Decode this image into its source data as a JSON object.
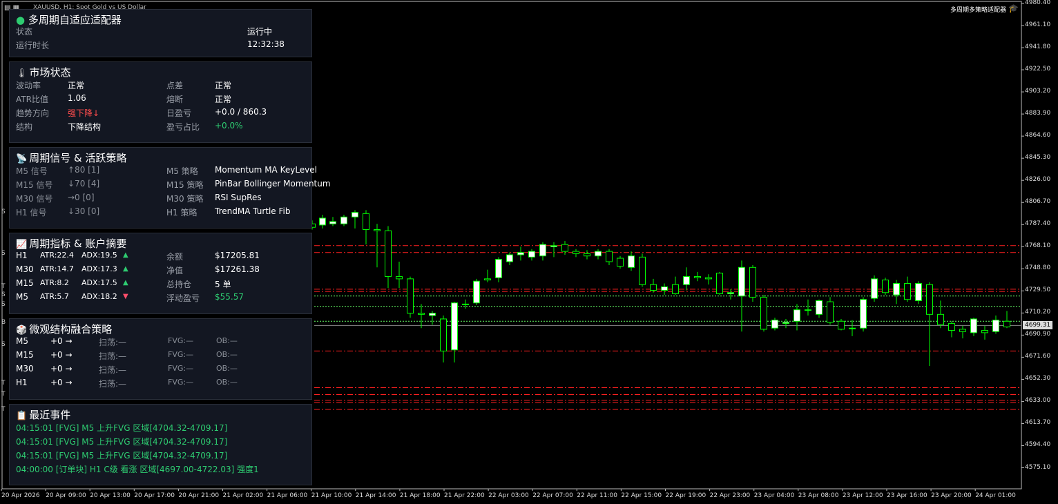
{
  "window": {
    "title": "XAUUSD, H1: Spot Gold vs US Dollar",
    "ea_name": "多周期多策略适配器"
  },
  "colors": {
    "background": "#000000",
    "bull": "#ffffff",
    "bear": "#ffffff",
    "wick": "#00ff00",
    "level_red": "#ff2020",
    "level_green": "#66ff66",
    "accent_green": "#2ecc71",
    "accent_red": "#ff4d4d"
  },
  "side_labels": [
    "S",
    "S",
    "T",
    "S",
    "S",
    "B",
    "S",
    "T",
    "T",
    "T"
  ],
  "y_axis": [
    "4980.40",
    "4961.10",
    "4941.80",
    "4922.50",
    "4903.20",
    "4883.90",
    "4864.60",
    "4845.30",
    "4826.00",
    "4806.70",
    "4787.40",
    "4768.10",
    "4748.80",
    "4729.50",
    "4710.20",
    "4690.90",
    "4671.60",
    "4652.30",
    "4633.00",
    "4613.70",
    "4594.40",
    "4575.10"
  ],
  "current_price": "4699.31",
  "x_axis": [
    "20 Apr 2026",
    "20 Apr 09:00",
    "20 Apr 13:00",
    "20 Apr 17:00",
    "20 Apr 21:00",
    "21 Apr 02:00",
    "21 Apr 06:00",
    "21 Apr 10:00",
    "21 Apr 14:00",
    "21 Apr 18:00",
    "21 Apr 22:00",
    "22 Apr 03:00",
    "22 Apr 07:00",
    "22 Apr 11:00",
    "22 Apr 15:00",
    "22 Apr 19:00",
    "22 Apr 23:00",
    "23 Apr 04:00",
    "23 Apr 08:00",
    "23 Apr 12:00",
    "23 Apr 16:00",
    "23 Apr 20:00",
    "24 Apr 01:00"
  ],
  "chart_data": {
    "type": "candlestick",
    "title": "XAUUSD, H1: Spot Gold vs US Dollar",
    "ylim": [
      4556,
      4981
    ],
    "current": 4699.31,
    "red_levels": [
      4769,
      4763,
      4731,
      4729,
      4677,
      4645,
      4639,
      4634,
      4632,
      4626
    ],
    "green_levels": [
      4725,
      4716,
      4703
    ],
    "candles": [
      {
        "x": 437,
        "o": 4790,
        "c": 4787,
        "h": 4793,
        "l": 4784
      },
      {
        "x": 452,
        "o": 4788,
        "c": 4785,
        "h": 4791,
        "l": 4783
      },
      {
        "x": 467,
        "o": 4787,
        "c": 4793,
        "h": 4796,
        "l": 4784
      },
      {
        "x": 482,
        "o": 4788,
        "c": 4790,
        "h": 4794,
        "l": 4786
      },
      {
        "x": 498,
        "o": 4788,
        "c": 4794,
        "h": 4796,
        "l": 4786
      },
      {
        "x": 514,
        "o": 4794,
        "c": 4798,
        "h": 4800,
        "l": 4784
      },
      {
        "x": 530,
        "o": 4797,
        "c": 4783,
        "h": 4800,
        "l": 4770
      },
      {
        "x": 546,
        "o": 4783,
        "c": 4782,
        "h": 4788,
        "l": 4750
      },
      {
        "x": 562,
        "o": 4782,
        "c": 4742,
        "h": 4786,
        "l": 4732
      },
      {
        "x": 578,
        "o": 4742,
        "c": 4740,
        "h": 4755,
        "l": 4732
      },
      {
        "x": 594,
        "o": 4740,
        "c": 4710,
        "h": 4742,
        "l": 4706
      },
      {
        "x": 610,
        "o": 4710,
        "c": 4709,
        "h": 4718,
        "l": 4697
      },
      {
        "x": 626,
        "o": 4708,
        "c": 4710,
        "h": 4712,
        "l": 4700
      },
      {
        "x": 642,
        "o": 4705,
        "c": 4677,
        "h": 4708,
        "l": 4667
      },
      {
        "x": 658,
        "o": 4678,
        "c": 4719,
        "h": 4720,
        "l": 4667
      },
      {
        "x": 674,
        "o": 4718,
        "c": 4718,
        "h": 4722,
        "l": 4714
      },
      {
        "x": 690,
        "o": 4719,
        "c": 4738,
        "h": 4740,
        "l": 4717
      },
      {
        "x": 706,
        "o": 4740,
        "c": 4739,
        "h": 4748,
        "l": 4737
      },
      {
        "x": 722,
        "o": 4741,
        "c": 4757,
        "h": 4759,
        "l": 4737
      },
      {
        "x": 738,
        "o": 4755,
        "c": 4761,
        "h": 4763,
        "l": 4752
      },
      {
        "x": 754,
        "o": 4761,
        "c": 4763,
        "h": 4768,
        "l": 4756
      },
      {
        "x": 770,
        "o": 4759,
        "c": 4764,
        "h": 4766,
        "l": 4756
      },
      {
        "x": 786,
        "o": 4760,
        "c": 4770,
        "h": 4772,
        "l": 4756
      },
      {
        "x": 802,
        "o": 4768,
        "c": 4769,
        "h": 4772,
        "l": 4759
      },
      {
        "x": 818,
        "o": 4770,
        "c": 4764,
        "h": 4773,
        "l": 4761
      },
      {
        "x": 834,
        "o": 4764,
        "c": 4762,
        "h": 4766,
        "l": 4759
      },
      {
        "x": 850,
        "o": 4762,
        "c": 4760,
        "h": 4765,
        "l": 4757
      },
      {
        "x": 866,
        "o": 4760,
        "c": 4764,
        "h": 4766,
        "l": 4757
      },
      {
        "x": 882,
        "o": 4764,
        "c": 4755,
        "h": 4766,
        "l": 4752
      },
      {
        "x": 898,
        "o": 4758,
        "c": 4751,
        "h": 4760,
        "l": 4749
      },
      {
        "x": 914,
        "o": 4750,
        "c": 4760,
        "h": 4764,
        "l": 4747
      },
      {
        "x": 930,
        "o": 4759,
        "c": 4735,
        "h": 4762,
        "l": 4733
      },
      {
        "x": 946,
        "o": 4735,
        "c": 4730,
        "h": 4740,
        "l": 4728
      },
      {
        "x": 962,
        "o": 4730,
        "c": 4733,
        "h": 4736,
        "l": 4726
      },
      {
        "x": 978,
        "o": 4735,
        "c": 4727,
        "h": 4742,
        "l": 4726
      },
      {
        "x": 994,
        "o": 4735,
        "c": 4742,
        "h": 4750,
        "l": 4730
      },
      {
        "x": 1010,
        "o": 4742,
        "c": 4741,
        "h": 4746,
        "l": 4738
      },
      {
        "x": 1026,
        "o": 4741,
        "c": 4740,
        "h": 4744,
        "l": 4735
      },
      {
        "x": 1042,
        "o": 4745,
        "c": 4727,
        "h": 4746,
        "l": 4726
      },
      {
        "x": 1058,
        "o": 4727,
        "c": 4728,
        "h": 4731,
        "l": 4722
      },
      {
        "x": 1074,
        "o": 4725,
        "c": 4750,
        "h": 4756,
        "l": 4694
      },
      {
        "x": 1090,
        "o": 4750,
        "c": 4724,
        "h": 4752,
        "l": 4720
      },
      {
        "x": 1106,
        "o": 4724,
        "c": 4696,
        "h": 4726,
        "l": 4694
      },
      {
        "x": 1122,
        "o": 4697,
        "c": 4704,
        "h": 4706,
        "l": 4695
      },
      {
        "x": 1138,
        "o": 4701,
        "c": 4702,
        "h": 4705,
        "l": 4697
      },
      {
        "x": 1154,
        "o": 4703,
        "c": 4713,
        "h": 4718,
        "l": 4695
      },
      {
        "x": 1170,
        "o": 4713,
        "c": 4713,
        "h": 4722,
        "l": 4708
      },
      {
        "x": 1186,
        "o": 4709,
        "c": 4721,
        "h": 4722,
        "l": 4706
      },
      {
        "x": 1202,
        "o": 4720,
        "c": 4702,
        "h": 4724,
        "l": 4700
      },
      {
        "x": 1218,
        "o": 4703,
        "c": 4696,
        "h": 4705,
        "l": 4695
      },
      {
        "x": 1234,
        "o": 4697,
        "c": 4697,
        "h": 4704,
        "l": 4690
      },
      {
        "x": 1250,
        "o": 4697,
        "c": 4722,
        "h": 4724,
        "l": 4694
      },
      {
        "x": 1266,
        "o": 4723,
        "c": 4740,
        "h": 4743,
        "l": 4720
      },
      {
        "x": 1282,
        "o": 4739,
        "c": 4728,
        "h": 4741,
        "l": 4726
      },
      {
        "x": 1298,
        "o": 4726,
        "c": 4736,
        "h": 4739,
        "l": 4718
      },
      {
        "x": 1314,
        "o": 4736,
        "c": 4722,
        "h": 4742,
        "l": 4720
      },
      {
        "x": 1330,
        "o": 4721,
        "c": 4736,
        "h": 4738,
        "l": 4718
      },
      {
        "x": 1346,
        "o": 4735,
        "c": 4709,
        "h": 4737,
        "l": 4664
      },
      {
        "x": 1362,
        "o": 4709,
        "c": 4700,
        "h": 4721,
        "l": 4697
      },
      {
        "x": 1378,
        "o": 4701,
        "c": 4695,
        "h": 4703,
        "l": 4689
      },
      {
        "x": 1394,
        "o": 4696,
        "c": 4694,
        "h": 4699,
        "l": 4688
      },
      {
        "x": 1410,
        "o": 4693,
        "c": 4705,
        "h": 4706,
        "l": 4690
      },
      {
        "x": 1426,
        "o": 4695,
        "c": 4693,
        "h": 4699,
        "l": 4687
      },
      {
        "x": 1442,
        "o": 4694,
        "c": 4704,
        "h": 4708,
        "l": 4692
      },
      {
        "x": 1458,
        "o": 4703,
        "c": 4698,
        "h": 4712,
        "l": 4697
      }
    ]
  },
  "panel1": {
    "title": "多周期自适应适配器",
    "rows": [
      {
        "label": "状态",
        "value": "运行中"
      },
      {
        "label": "运行时长",
        "value": "12:32:38"
      }
    ]
  },
  "panel2": {
    "title": "市场状态",
    "rows": [
      {
        "l1": "波动率",
        "v1": "正常",
        "l2": "点差",
        "v2": "正常"
      },
      {
        "l1": "ATR比值",
        "v1": "1.06",
        "l2": "熔断",
        "v2": "正常"
      },
      {
        "l1": "趋势方向",
        "v1": "强下降↓",
        "l2": "日盈亏",
        "v2": "+0.0 / 860.3"
      },
      {
        "l1": "结构",
        "v1": "下降结构",
        "l2": "盈亏占比",
        "v2": "+0.0%"
      }
    ]
  },
  "panel3": {
    "title": "周期信号 & 活跃策略",
    "rows": [
      {
        "l1": "M5 信号",
        "v1": "↑80  [1]",
        "l2": "M5 策略",
        "v2": "Momentum MA KeyLevel"
      },
      {
        "l1": "M15 信号",
        "v1": "↓70  [4]",
        "l2": "M15 策略",
        "v2": "PinBar Bollinger Momentum"
      },
      {
        "l1": "M30 信号",
        "v1": "→0  [0]",
        "l2": "M30 策略",
        "v2": "RSI SupRes"
      },
      {
        "l1": "H1 信号",
        "v1": "↓30  [0]",
        "l2": "H1 策略",
        "v2": "TrendMA Turtle Fib"
      }
    ]
  },
  "panel4": {
    "title": "周期指标 & 账户摘要",
    "rows": [
      {
        "tf": "H1",
        "atr": "ATR:22.4",
        "adx": "ADX:19.5",
        "dir": "up",
        "l2": "余额",
        "v2": "$17205.81"
      },
      {
        "tf": "M30",
        "atr": "ATR:14.7",
        "adx": "ADX:17.3",
        "dir": "up",
        "l2": "净值",
        "v2": "$17261.38"
      },
      {
        "tf": "M15",
        "atr": "ATR:8.2",
        "adx": "ADX:17.5",
        "dir": "up",
        "l2": "总持仓",
        "v2": "5 单"
      },
      {
        "tf": "M5",
        "atr": "ATR:5.7",
        "adx": "ADX:18.2",
        "dir": "down",
        "l2": "浮动盈亏",
        "v2": "$55.57"
      }
    ]
  },
  "panel5": {
    "title": "微观结构融合策略",
    "rows": [
      {
        "tf": "M5",
        "sig": "+0 →",
        "sweep": "扫荡:—",
        "fvg": "FVG:—",
        "ob": "OB:—"
      },
      {
        "tf": "M15",
        "sig": "+0 →",
        "sweep": "扫荡:—",
        "fvg": "FVG:—",
        "ob": "OB:—"
      },
      {
        "tf": "M30",
        "sig": "+0 →",
        "sweep": "扫荡:—",
        "fvg": "FVG:—",
        "ob": "OB:—"
      },
      {
        "tf": "H1",
        "sig": "+0 →",
        "sweep": "扫荡:—",
        "fvg": "FVG:—",
        "ob": "OB:—"
      }
    ]
  },
  "panel6": {
    "title": "最近事件",
    "events": [
      "04:15:01 [FVG] M5 上升FVG 区域[4704.32-4709.17]",
      "04:15:01 [FVG] M5 上升FVG 区域[4704.32-4709.17]",
      "04:15:01 [FVG] M5 上升FVG 区域[4704.32-4709.17]",
      "04:00:00 [订单块] H1 C级 看涨 区域[4697.00-4722.03] 强度1"
    ]
  }
}
